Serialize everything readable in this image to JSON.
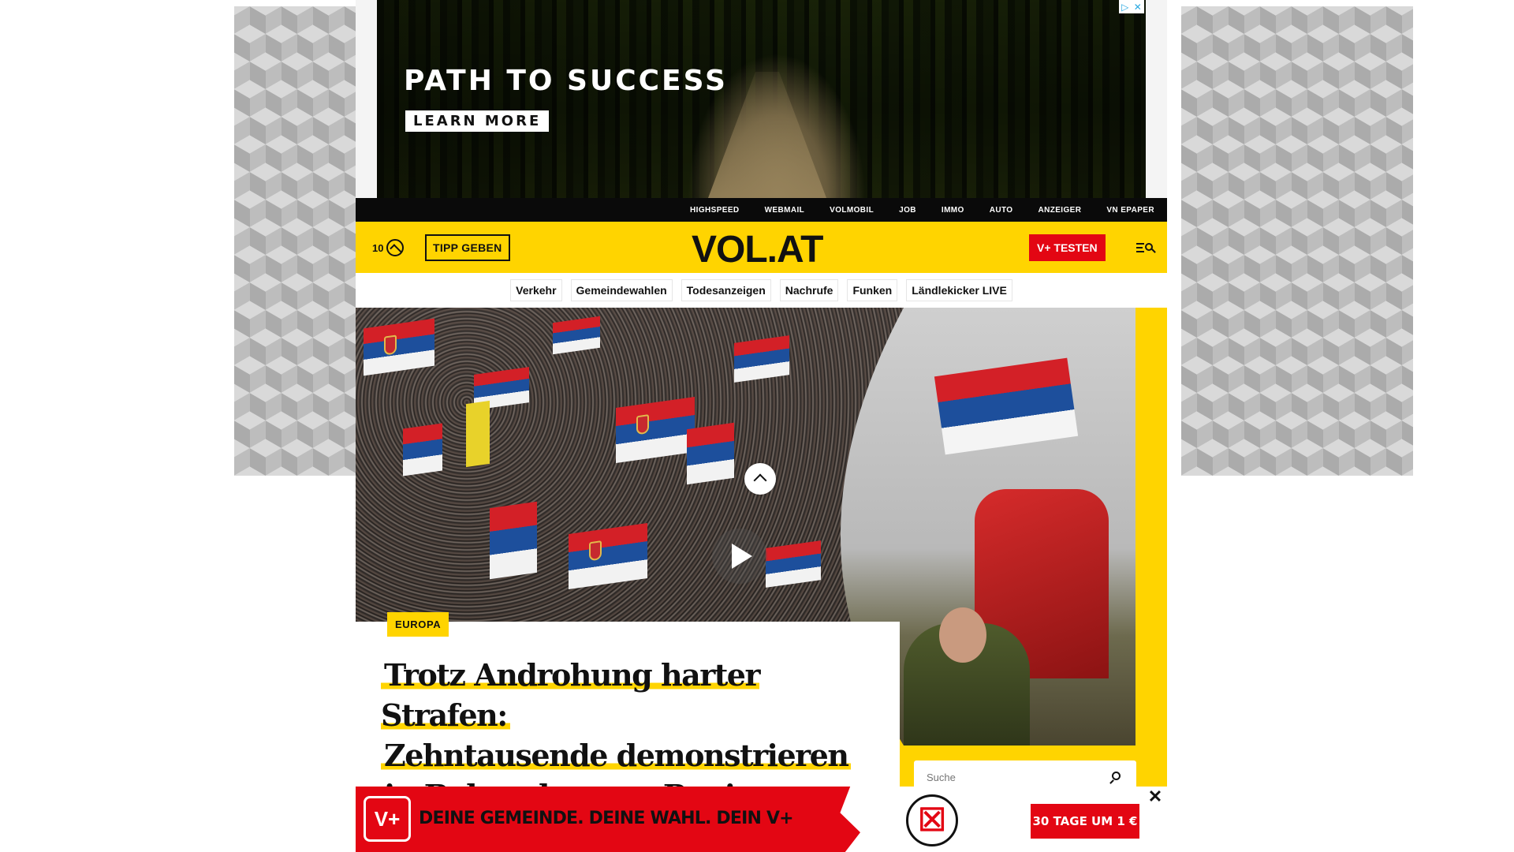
{
  "top_ad": {
    "headline": "PATH TO SUCCESS",
    "cta": "LEARN MORE",
    "adchoices_icon": "adchoices-icon",
    "close_icon": "close-icon"
  },
  "service_nav": [
    "HIGHSPEED",
    "WEBMAIL",
    "VOLMOBIL",
    "JOB",
    "IMMO",
    "AUTO",
    "ANZEIGER",
    "VN EPAPER"
  ],
  "header": {
    "weather_temp": "10",
    "weather_icon": "mountain-weather-icon",
    "tipp_button": "TIPP GEBEN",
    "logo": "VOL.AT",
    "vplus_button": "V+ TESTEN",
    "menu_icon": "menu-search-icon",
    "brand_color": "#ffd400",
    "accent_color": "#e30613"
  },
  "topics": [
    "Verkehr",
    "Gemeindewahlen",
    "Todesanzeigen",
    "Nachrufe",
    "Funken",
    "Ländlekicker LIVE"
  ],
  "hero": {
    "kicker": "EUROPA",
    "headline_lines": [
      "Trotz Androhung harter Strafen:",
      "Zehntausende demonstrieren",
      "in Belgrad gegen Regierung"
    ],
    "play_icon": "play-icon"
  },
  "search": {
    "placeholder": "Suche"
  },
  "bottom_banner": {
    "logo": "V+",
    "text": "DEINE GEMEINDE. DEINE WAHL. DEIN V+",
    "ballot_icon": "ballot-icon",
    "cta": "30 TAGE UM 1 €",
    "close": "✕"
  }
}
